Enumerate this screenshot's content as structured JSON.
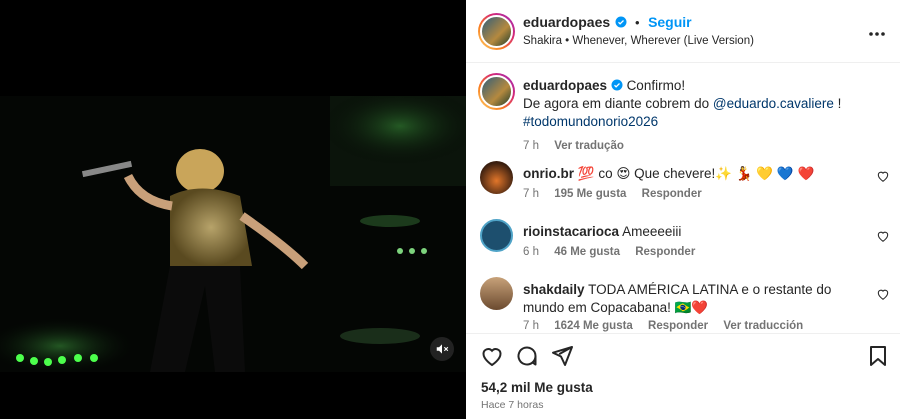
{
  "post": {
    "username": "eduardopaes",
    "follow_label": "Seguir",
    "separator": "•",
    "song": "Shakira • Whenever, Wherever (Live Version)"
  },
  "caption": {
    "username": "eduardopaes",
    "text_1": "Confirmo!",
    "text_2": "De agora em diante cobrem do",
    "mention": "@eduardo.cavaliere",
    "text_3": "!",
    "hashtag": "#todomundonorio2026",
    "time": "7 h",
    "translate": "Ver tradução"
  },
  "comments": [
    {
      "username": "onrio.br",
      "text": "💯 co 😍 Que chevere!✨ 💃 💛 💙 ❤️",
      "time": "7 h",
      "likes": "195 Me gusta",
      "reply": "Responder"
    },
    {
      "username": "rioinstacarioca",
      "text": "Ameeeeiii",
      "time": "6 h",
      "likes": "46 Me gusta",
      "reply": "Responder"
    },
    {
      "username": "shakdaily",
      "text": "TODA AMÉRICA LATINA e o restante do mundo em Copacabana! 🇧🇷❤️",
      "time": "7 h",
      "likes": "1624 Me gusta",
      "reply": "Responder",
      "translate": "Ver traducción"
    }
  ],
  "footer": {
    "likes": "54,2 mil Me gusta",
    "time_ago": "Hace 7 horas"
  },
  "icons": {
    "heart": "heart-icon",
    "comment": "comment-icon",
    "share": "share-icon",
    "save": "bookmark-icon",
    "mute": "muted-speaker-icon",
    "more": "more-options-icon",
    "verified": "verified-badge-icon"
  },
  "colors": {
    "accent": "#0095f6",
    "link": "#00376b",
    "verified": "#0095f6",
    "muted": "#737373"
  }
}
